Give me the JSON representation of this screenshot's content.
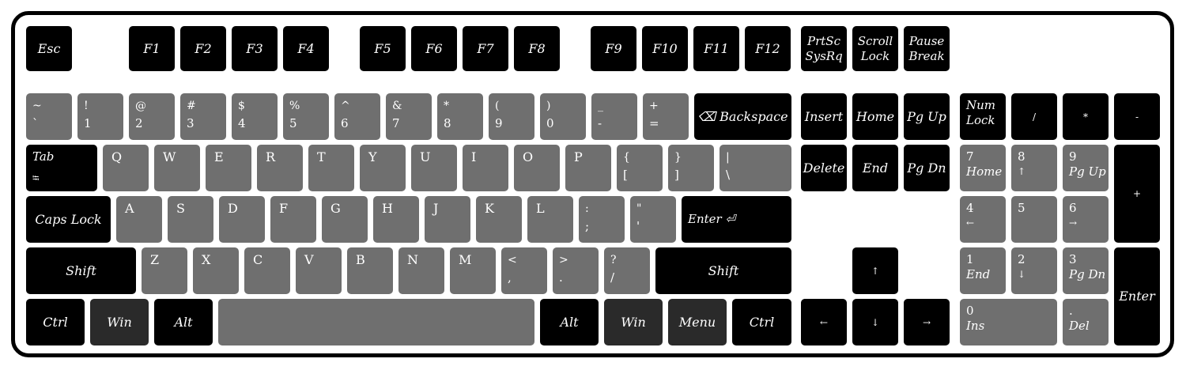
{
  "keys": {
    "esc": "Esc",
    "f1": "F1",
    "f2": "F2",
    "f3": "F3",
    "f4": "F4",
    "f5": "F5",
    "f6": "F6",
    "f7": "F7",
    "f8": "F8",
    "f9": "F9",
    "f10": "F10",
    "f11": "F11",
    "f12": "F12",
    "prtsc": [
      "PrtSc",
      "SysRq"
    ],
    "scroll": [
      "Scroll",
      "Lock"
    ],
    "pause": [
      "Pause",
      "Break"
    ],
    "tilde": [
      "~",
      "`"
    ],
    "k1": [
      "!",
      "1"
    ],
    "k2": [
      "@",
      "2"
    ],
    "k3": [
      "#",
      "3"
    ],
    "k4": [
      "$",
      "4"
    ],
    "k5": [
      "%",
      "5"
    ],
    "k6": [
      "^",
      "6"
    ],
    "k7": [
      "&",
      "7"
    ],
    "k8": [
      "*",
      "8"
    ],
    "k9": [
      "(",
      "9"
    ],
    "k0": [
      ")",
      "0"
    ],
    "minus": [
      "_",
      "-"
    ],
    "equal": [
      "+",
      "="
    ],
    "backspace": "⌫ Backspace",
    "insert": "Insert",
    "home": "Home",
    "pgup": "Pg Up",
    "numlock": [
      "Num",
      "Lock"
    ],
    "npdiv": "/",
    "npmul": "*",
    "npsub": "-",
    "tab": "Tab",
    "tab_glyph": "⭾",
    "q": "Q",
    "w": "W",
    "e": "E",
    "r": "R",
    "t": "T",
    "y": "Y",
    "u": "U",
    "i": "I",
    "o": "O",
    "p": "P",
    "lbracket": [
      "{",
      "["
    ],
    "rbracket": [
      "}",
      "]"
    ],
    "backslash": [
      "|",
      "\\"
    ],
    "delete": "Delete",
    "end": "End",
    "pgdn": "Pg Dn",
    "np7": [
      "7",
      "Home"
    ],
    "np8": [
      "8",
      "↑"
    ],
    "np9": [
      "9",
      "Pg Up"
    ],
    "npadd": "+",
    "caps": "Caps Lock",
    "a": "A",
    "s": "S",
    "d": "D",
    "f": "F",
    "g": "G",
    "h": "H",
    "j": "J",
    "k": "K",
    "l": "L",
    "semicolon": [
      ":",
      ";"
    ],
    "quote": [
      "\"",
      "'"
    ],
    "enter": "Enter ⏎",
    "np4": [
      "4",
      "←"
    ],
    "np5": "5",
    "np6": [
      "6",
      "→"
    ],
    "lshift": "Shift",
    "z": "Z",
    "x": "X",
    "c": "C",
    "v": "V",
    "b": "B",
    "n": "N",
    "m": "M",
    "comma": [
      "<",
      ","
    ],
    "period": [
      ">",
      "."
    ],
    "slash": [
      "?",
      "/"
    ],
    "rshift": "Shift",
    "up": "↑",
    "np1": [
      "1",
      "End"
    ],
    "np2": [
      "2",
      "↓"
    ],
    "np3": [
      "3",
      "Pg Dn"
    ],
    "npenter": "Enter",
    "lctrl": "Ctrl",
    "lwin": "Win",
    "lalt": "Alt",
    "space": "",
    "ralt": "Alt",
    "rwin": "Win",
    "menu": "Menu",
    "rctrl": "Ctrl",
    "left": "←",
    "down": "↓",
    "right": "→",
    "np0": [
      "0",
      "Ins"
    ],
    "npdot": [
      ".",
      "Del"
    ]
  },
  "colors": {
    "primary_key": "#000000",
    "secondary_key": "#6f6f6f",
    "modifier_key": "#2a2a2a",
    "frame": "#000000",
    "legend": "#ffffff"
  }
}
